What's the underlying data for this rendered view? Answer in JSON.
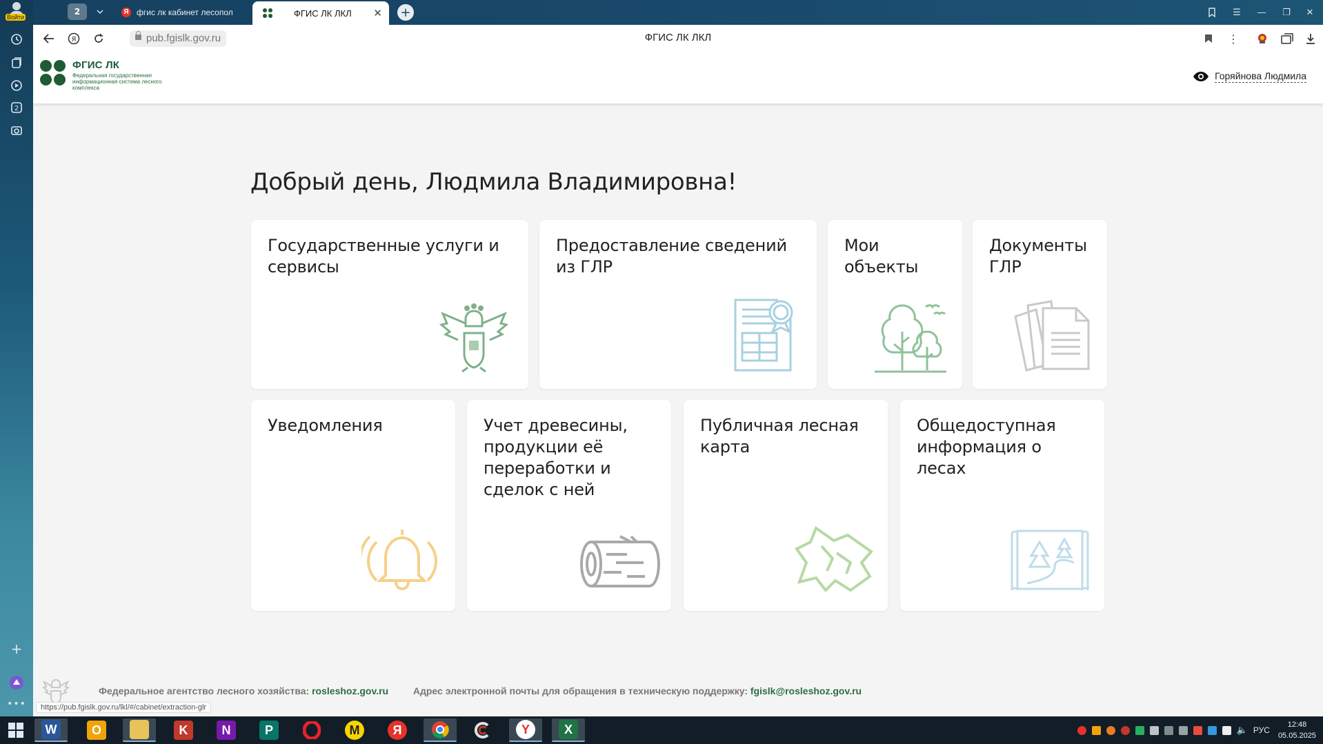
{
  "browser": {
    "profile_label": "Войти",
    "tab_count": "2",
    "tabs": [
      {
        "title": "фгис лк кабинет лесопол"
      },
      {
        "title": "ФГИС ЛК ЛКЛ"
      }
    ],
    "address": {
      "host": "pub.fgislk.gov.ru",
      "page_title": "ФГИС ЛК ЛКЛ"
    },
    "status_url": "https://pub.fgislk.gov.ru/lkl/#/cabinet/extraction-glr"
  },
  "site": {
    "logo_title": "ФГИС ЛК",
    "logo_subtitle": "Федеральная государственная информационная система лесного комплекса",
    "user_name": "Горяйнова Людмила",
    "greeting": "Добрый день, Людмила Владимировна!",
    "cards": [
      {
        "title": "Государственные услуги и сервисы",
        "icon": "coat-of-arms-icon"
      },
      {
        "title": "Предоставление сведений из ГЛР",
        "icon": "document-stamp-icon"
      },
      {
        "title": "Мои объекты",
        "icon": "trees-icon"
      },
      {
        "title": "Документы ГЛР",
        "icon": "documents-icon"
      },
      {
        "title": "Уведомления",
        "icon": "bell-icon"
      },
      {
        "title": "Учет древесины, продукции её переработки и сделок с ней",
        "icon": "log-icon"
      },
      {
        "title": "Публичная лесная карта",
        "icon": "map-icon"
      },
      {
        "title": "Общедоступная информация о лесах",
        "icon": "forest-scroll-icon"
      }
    ],
    "footer": {
      "agency_label": "Федеральное агентство лесного хозяйства:",
      "agency_link": "rosleshoz.gov.ru",
      "support_label": "Адрес электронной почты для обращения в техническую поддержку:",
      "support_email": "fgislk@rosleshoz.gov.ru"
    }
  },
  "taskbar": {
    "apps": [
      "Word",
      "Outlook",
      "File Explorer",
      "Kaspersky",
      "OneNote",
      "Publisher",
      "Opera",
      "Yandex Market",
      "Yandex",
      "Chrome",
      "CCleaner",
      "Yandex Browser",
      "Excel"
    ],
    "language": "РУС",
    "time": "12:48",
    "date": "05.05.2025"
  },
  "colors": {
    "brand_green": "#1f5c34",
    "link_green": "#2d6e43",
    "page_bg": "#f4f4f4"
  }
}
